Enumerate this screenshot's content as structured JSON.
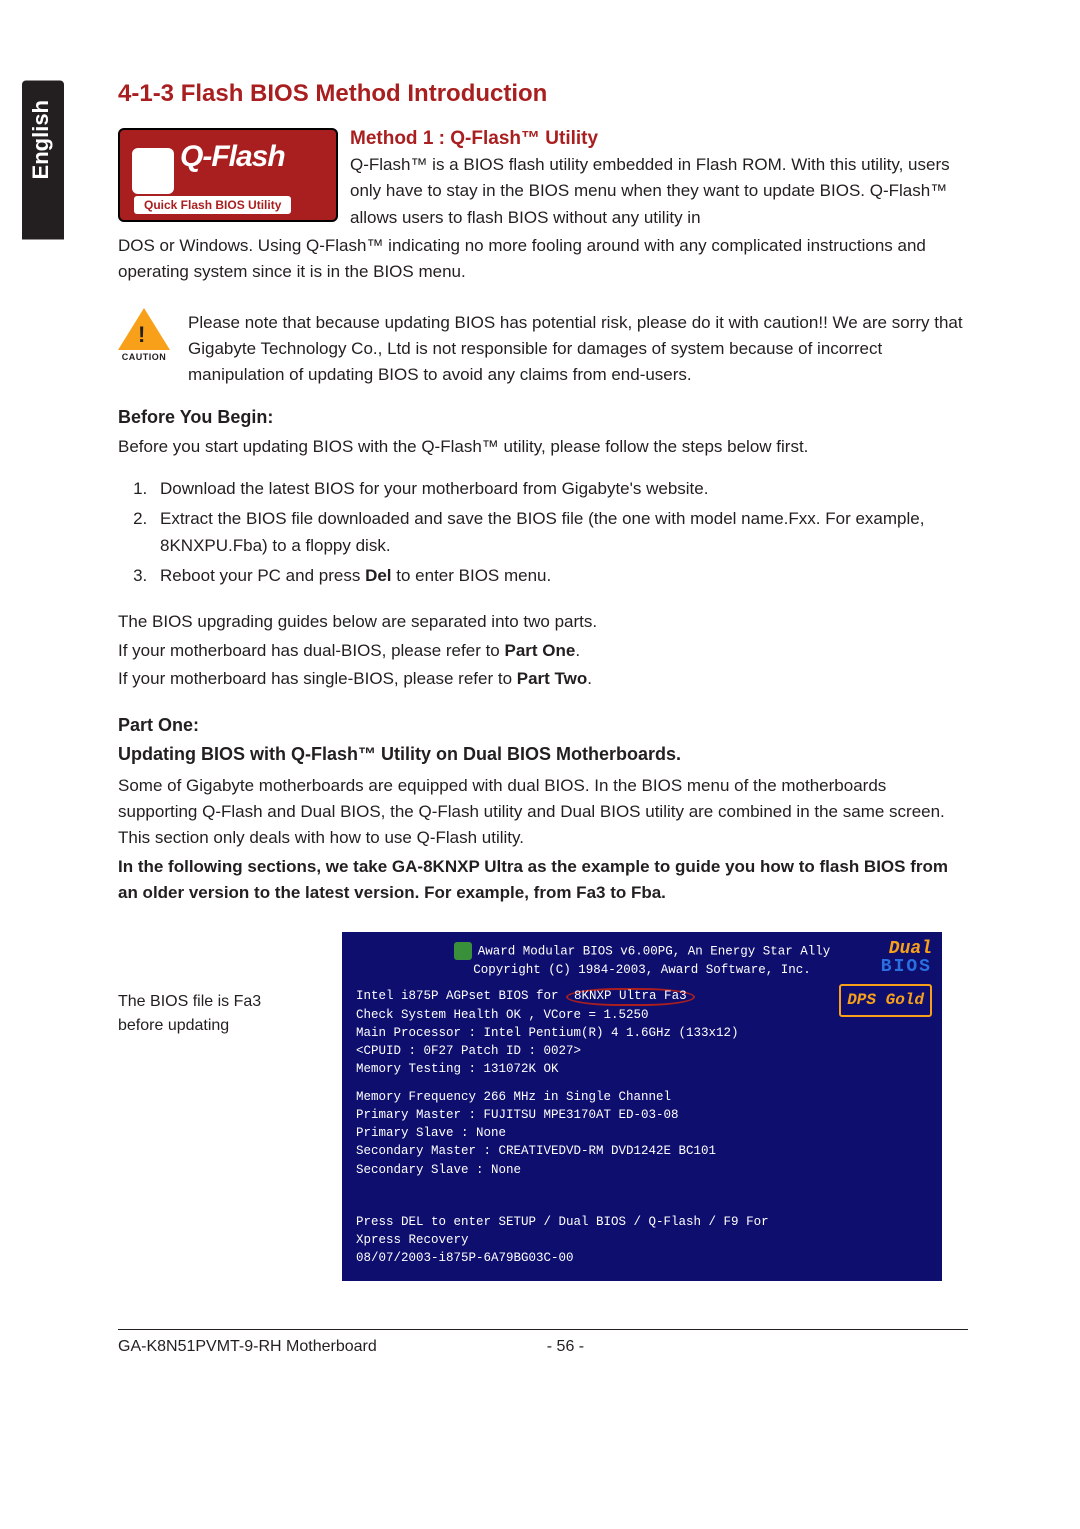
{
  "language_tab": "English",
  "section_title": "4-1-3   Flash BIOS Method Introduction",
  "logo": {
    "main": "Q-Flash",
    "sub": "Quick Flash BIOS Utility"
  },
  "method1": {
    "title": "Method 1 : Q-Flash™ Utility",
    "intro1": "Q-Flash™ is a BIOS flash utility embedded in Flash ROM. With this utility, users only have to stay in the BIOS menu when they want to update BIOS. Q-Flash™ allows users to flash BIOS without any utility in",
    "intro2": "DOS or Windows. Using Q-Flash™ indicating no more fooling around with any complicated instructions and operating system since it is in the BIOS menu."
  },
  "caution": {
    "label": "CAUTION",
    "text": "Please note that because updating BIOS has potential risk, please do it with caution!! We are sorry that Gigabyte Technology Co., Ltd is not responsible for damages of system because of incorrect manipulation of updating BIOS to avoid any claims from end-users."
  },
  "before": {
    "heading": "Before You Begin:",
    "lead": "Before you start updating BIOS with the Q-Flash™ utility, please follow the steps below first.",
    "steps": [
      "Download the latest BIOS for your motherboard from Gigabyte's website.",
      "Extract the BIOS file downloaded and save the BIOS file (the one with model name.Fxx. For example, 8KNXPU.Fba) to a floppy disk.",
      "Reboot your PC and press Del to enter BIOS menu."
    ],
    "guides1": "The BIOS upgrading guides below are separated into two parts.",
    "guides2a": "If your motherboard has dual-BIOS, please refer to ",
    "guides2b": "Part One",
    "guides3a": "If your motherboard has single-BIOS, please refer to ",
    "guides3b": "Part Two"
  },
  "part_one": {
    "heading": "Part One:",
    "sub": "Updating BIOS with Q-Flash™ Utility on Dual BIOS Motherboards.",
    "para": "Some of Gigabyte motherboards are equipped with dual BIOS. In the BIOS menu of the motherboards supporting Q-Flash and Dual BIOS, the Q-Flash utility and Dual BIOS utility are combined in the same screen. This section only deals with how to use Q-Flash utility.",
    "bold": "In the following sections, we take GA-8KNXP Ultra as the example to guide you how to flash BIOS from an older version to the latest version. For example, from Fa3 to Fba."
  },
  "bios_side": "The BIOS file is Fa3 before updating",
  "bios": {
    "header1": "Award Modular BIOS v6.00PG, An Energy Star Ally",
    "header2": "Copyright  (C) 1984-2003, Award Software,  Inc.",
    "line1a": "Intel i875P AGPset BIOS for ",
    "line1b": "8KNXP Ultra Fa3",
    "line2": "Check System Health OK , VCore = 1.5250",
    "line3": "Main Processor :  Intel Pentium(R) 4  1.6GHz (133x12)",
    "line4": "<CPUID : 0F27 Patch ID  : 0027>",
    "line5": "Memory Testing  : 131072K OK",
    "line6": "Memory Frequency 266 MHz in Single Channel",
    "line7": "Primary Master : FUJITSU MPE3170AT ED-03-08",
    "line8": "Primary Slave : None",
    "line9": "Secondary Master :  CREATIVEDVD-RM DVD1242E BC101",
    "line10": "Secondary Slave : None",
    "press1": "Press DEL to enter SETUP / Dual BIOS / Q-Flash / F9 For",
    "press2": "Xpress Recovery",
    "press3": "08/07/2003-i875P-6A79BG03C-00",
    "badge_dual1": "Dual",
    "badge_dual2": "BIOS",
    "badge_dps": "DPS Gold"
  },
  "footer": {
    "model": "GA-K8N51PVMT-9-RH Motherboard",
    "page": "- 56 -"
  }
}
